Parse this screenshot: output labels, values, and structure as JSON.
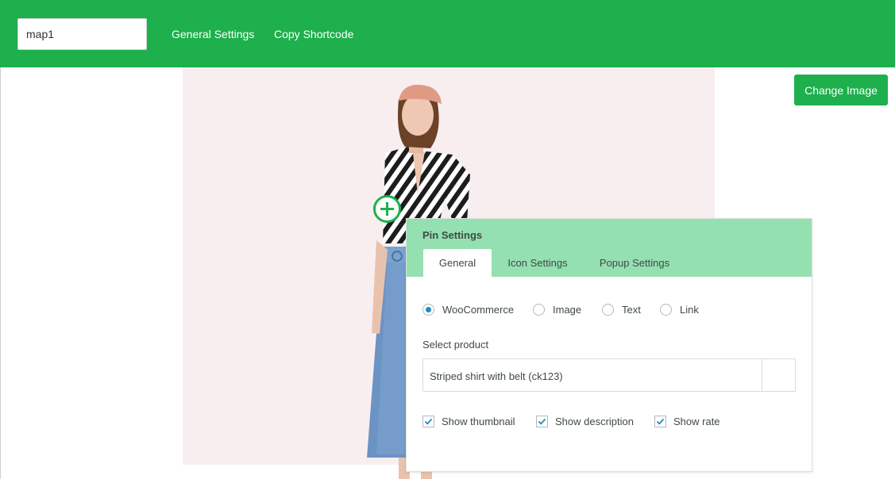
{
  "header": {
    "map_name_value": "map1",
    "links": {
      "general_settings": "General Settings",
      "copy_shortcode": "Copy Shortcode"
    }
  },
  "toolbar": {
    "change_image_label": "Change Image"
  },
  "pin": {
    "icon": "plus-circle-icon"
  },
  "pin_settings": {
    "title": "Pin Settings",
    "tabs": {
      "general": "General",
      "icon_settings": "Icon Settings",
      "popup_settings": "Popup Settings"
    },
    "type_options": {
      "woocommerce": "WooCommerce",
      "image": "Image",
      "text": "Text",
      "link": "Link"
    },
    "selected_type": "WooCommerce",
    "select_product_label": "Select product",
    "selected_product": "Striped shirt with belt (ck123)",
    "checkboxes": {
      "show_thumbnail": "Show thumbnail",
      "show_description": "Show description",
      "show_rate": "Show rate"
    },
    "checked": [
      true,
      true,
      true
    ]
  },
  "colors": {
    "brand": "#1db04c",
    "panel_header": "#94e0b1",
    "canvas_bg": "#f8eef0",
    "radio_selected": "#1e8cbe"
  }
}
